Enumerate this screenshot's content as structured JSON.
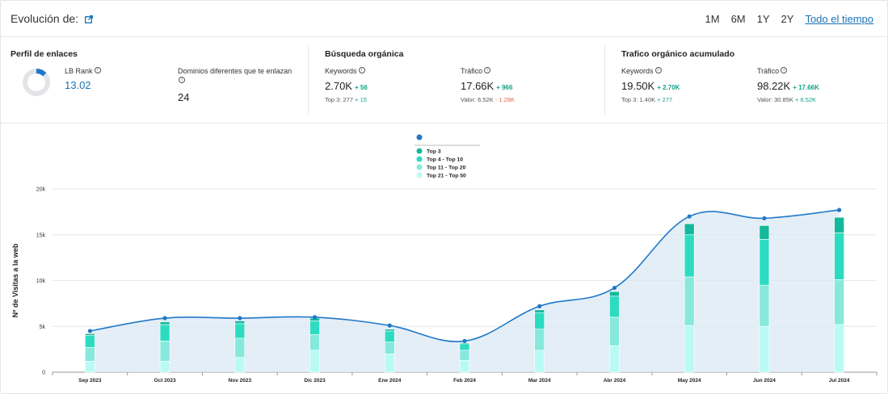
{
  "header": {
    "title": "Evolución de:",
    "ranges": [
      "1M",
      "6M",
      "1Y",
      "2Y"
    ],
    "all_time": "Todo el tiempo"
  },
  "perfil": {
    "title": "Perfil de enlaces",
    "lb_rank_label": "LB Rank",
    "lb_rank_value": "13.02",
    "domains_label": "Dominios diferentes que te enlazan",
    "domains_value": "24"
  },
  "busqueda": {
    "title": "Búsqueda orgánica",
    "keywords_label": "Keywords",
    "keywords_value": "2.70K",
    "keywords_delta": "+ 56",
    "top3_label": "Top 3: 277",
    "top3_delta": "+ 15",
    "trafico_label": "Tráfico",
    "trafico_value": "17.66K",
    "trafico_delta": "+ 966",
    "valor_label": "Valor: 6.52K",
    "valor_delta": "- 1.28K"
  },
  "acumulado": {
    "title": "Trafico orgánico acumulado",
    "keywords_label": "Keywords",
    "keywords_value": "19.50K",
    "keywords_delta": "+ 2.70K",
    "top3_label": "Top 3: 1.40K",
    "top3_delta": "+ 277",
    "trafico_label": "Tráfico",
    "trafico_value": "98.22K",
    "trafico_delta": "+ 17.66K",
    "valor_label": "Valor: 30.85K",
    "valor_delta": "+ 6.52K"
  },
  "colors": {
    "accent": "#1a73b5",
    "line": "#1f78c8",
    "area": "#dbe8f4",
    "top3": "#14b89a",
    "top4_10": "#2ddcc0",
    "top11_20": "#86e9db",
    "top21_50": "#b9fbf4"
  },
  "chart_data": {
    "type": "bar",
    "ylabel": "Nº de Visitas a la web",
    "ylim": [
      0,
      20000
    ],
    "yticks": [
      "0",
      "5k",
      "10k",
      "15k",
      "20k"
    ],
    "ytick_values": [
      0,
      5000,
      10000,
      15000,
      20000
    ],
    "categories": [
      "Sep 2023",
      "Oct 2023",
      "Nov 2023",
      "Dic 2023",
      "Ene 2024",
      "Feb 2024",
      "Mar 2024",
      "Abr 2024",
      "May 2024",
      "Jun 2024",
      "Jul 2024"
    ],
    "legend": [
      "Top 3",
      "Top 4 - Top 10",
      "Top 11 - Top 20",
      "Top 21 - Top 50"
    ],
    "legend_position": "top-center",
    "grid": true,
    "series": [
      {
        "name": "Top 21 - Top 50",
        "values": [
          1200,
          1200,
          1600,
          2400,
          2000,
          1300,
          2400,
          2900,
          5100,
          5000,
          5200
        ]
      },
      {
        "name": "Top 11 - Top 20",
        "values": [
          1500,
          2200,
          2100,
          1700,
          1300,
          1100,
          2300,
          3100,
          5300,
          4500,
          4900
        ]
      },
      {
        "name": "Top 4 - Top 10",
        "values": [
          1300,
          1800,
          1600,
          1500,
          1200,
          700,
          1800,
          2300,
          4600,
          5000,
          5100
        ]
      },
      {
        "name": "Top 3",
        "values": [
          200,
          300,
          300,
          300,
          200,
          100,
          300,
          500,
          1200,
          1500,
          1700
        ]
      }
    ],
    "total_line": [
      4500,
      5900,
      5900,
      6000,
      5100,
      3400,
      7200,
      9200,
      17000,
      16800,
      17700
    ]
  }
}
